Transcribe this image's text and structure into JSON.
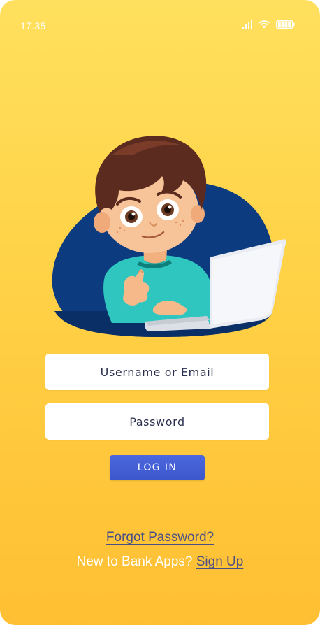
{
  "status_bar": {
    "time": "17.35",
    "icons": [
      "signal-icon",
      "wifi-icon",
      "battery-icon"
    ]
  },
  "illustration": {
    "subject": "boy-with-laptop-thumbs-up"
  },
  "login_form": {
    "username_placeholder": "Username or Email",
    "password_placeholder": "Password",
    "login_label": "LOG IN"
  },
  "footer": {
    "forgot_label": "Forgot Password?",
    "signup_prompt": "New to Bank Apps?",
    "signup_label": "Sign Up"
  },
  "colors": {
    "background_top": "#ffe05e",
    "background_bottom": "#ffbf33",
    "button": "#4560d6",
    "link": "#4a4f86",
    "blob": "#0d3b80"
  }
}
